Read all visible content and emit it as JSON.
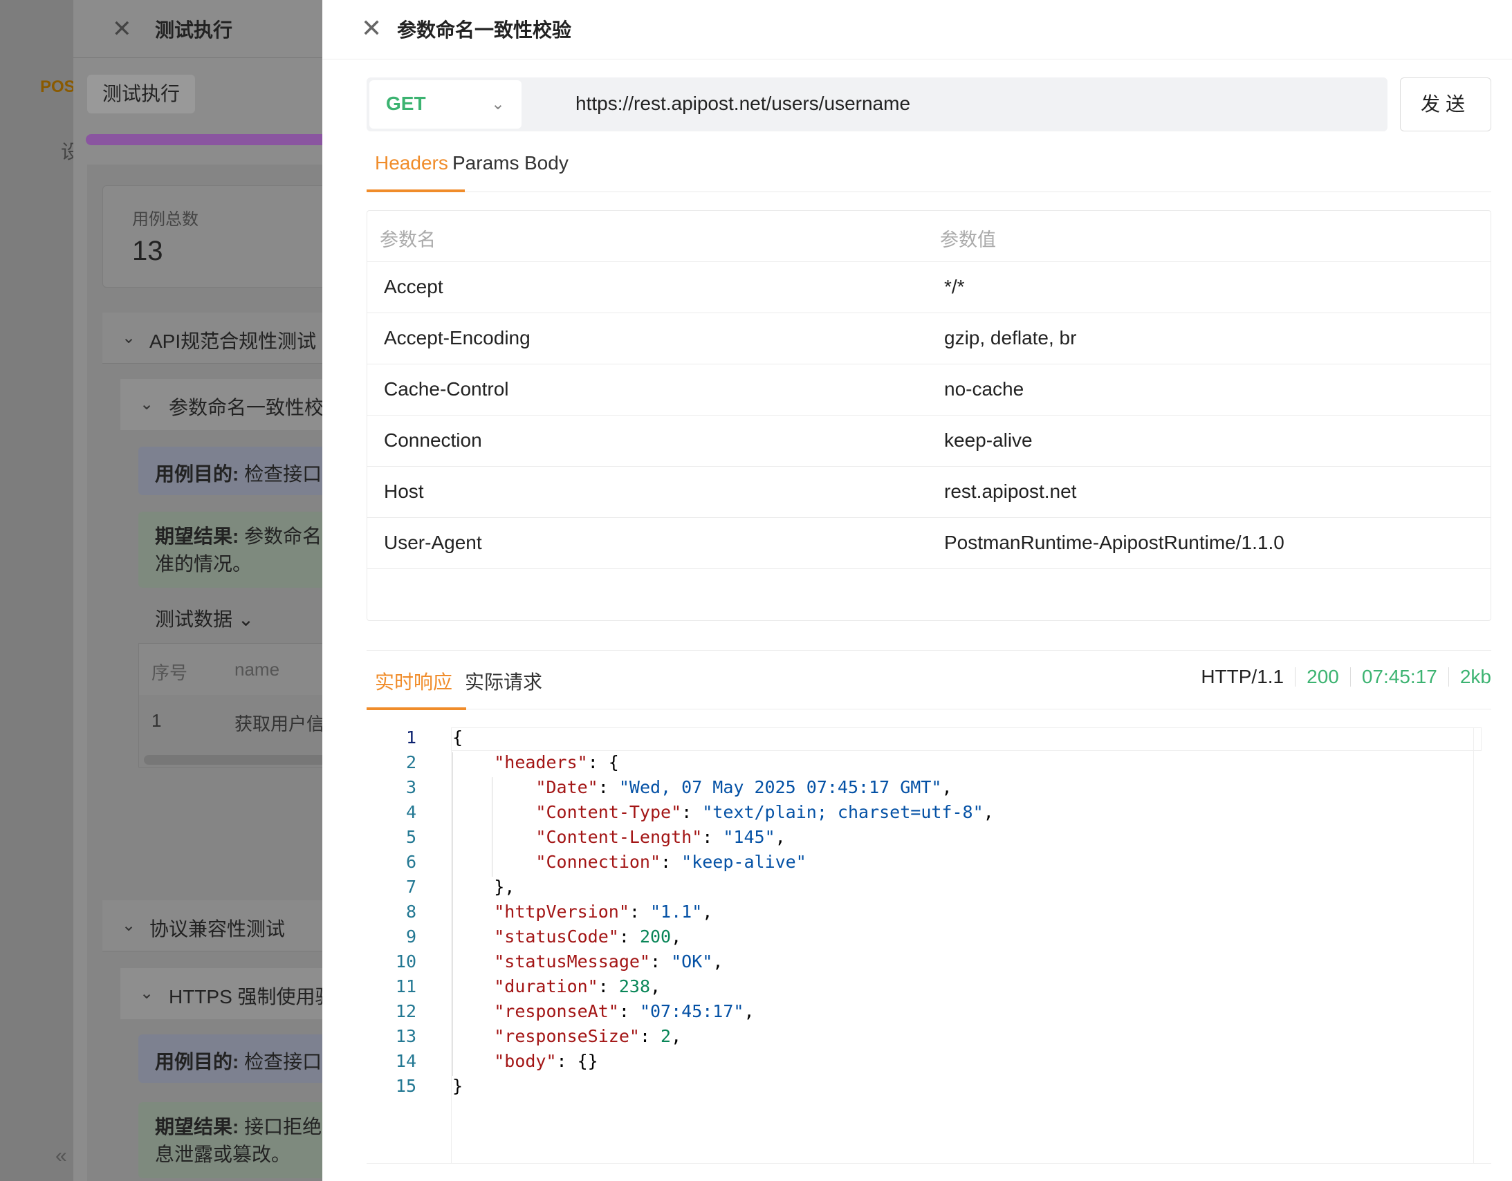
{
  "background_app": {
    "brand_fragment": "POS",
    "side_char": "设",
    "collapse_icon": "«"
  },
  "mid_drawer": {
    "title": "测试执行",
    "tab": "测试执行",
    "stat": {
      "label": "用例总数",
      "value": "13"
    },
    "group1": {
      "name": "API规范合规性测试"
    },
    "case1": {
      "name": "参数命名一致性校",
      "purpose_label": "用例目的:",
      "purpose_text": " 检查接口",
      "expect_label": "期望结果:",
      "expect_text": " 参数命名",
      "expect_text2": "准的情况。"
    },
    "test_data_label": "测试数据",
    "table": {
      "col1": "序号",
      "col2": "name",
      "row1_c1": "1",
      "row1_c2": "获取用户信"
    },
    "group2": {
      "name": "协议兼容性测试"
    },
    "case2": {
      "name": "HTTPS 强制使用验",
      "purpose_label": "用例目的:",
      "purpose_text": " 检查接口",
      "expect_label": "期望结果:",
      "expect_text": " 接口拒绝",
      "expect_text2": "息泄露或篡改。"
    }
  },
  "main_drawer": {
    "title": "参数命名一致性校验",
    "method": "GET",
    "url": "https://rest.apipost.net/users/username",
    "send_label": "发送",
    "tabs": [
      "Headers",
      "Params",
      "Body"
    ],
    "headers_table": {
      "col_name": "参数名",
      "col_value": "参数值",
      "rows": [
        {
          "k": "Accept",
          "v": "*/*"
        },
        {
          "k": "Accept-Encoding",
          "v": "gzip, deflate, br"
        },
        {
          "k": "Cache-Control",
          "v": "no-cache"
        },
        {
          "k": "Connection",
          "v": "keep-alive"
        },
        {
          "k": "Host",
          "v": "rest.apipost.net"
        },
        {
          "k": "User-Agent",
          "v": "PostmanRuntime-ApipostRuntime/1.1.0"
        }
      ]
    },
    "response_tabs": [
      "实时响应",
      "实际请求"
    ],
    "response_meta": {
      "protocol": "HTTP/1.1",
      "status": "200",
      "time": "07:45:17",
      "size": "2kb"
    },
    "code_lines": [
      "{",
      "    \"headers\": {",
      "        \"Date\": \"Wed, 07 May 2025 07:45:17 GMT\",",
      "        \"Content-Type\": \"text/plain; charset=utf-8\",",
      "        \"Content-Length\": \"145\",",
      "        \"Connection\": \"keep-alive\"",
      "    },",
      "    \"httpVersion\": \"1.1\",",
      "    \"statusCode\": 200,",
      "    \"statusMessage\": \"OK\",",
      "    \"duration\": 238,",
      "    \"responseAt\": \"07:45:17\",",
      "    \"responseSize\": 2,",
      "    \"body\": {}",
      "}"
    ]
  },
  "colors": {
    "accent": "#f08c2a",
    "success": "#3cb371",
    "key": "#a31515",
    "string": "#0451a5",
    "number": "#098658"
  }
}
